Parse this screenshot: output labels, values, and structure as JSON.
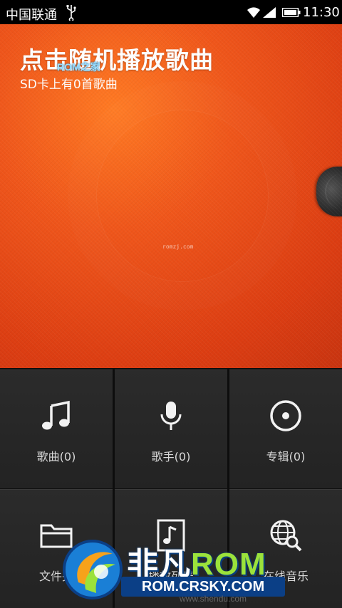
{
  "status_bar": {
    "carrier": "中国联通",
    "time": "11:30",
    "icons": [
      "usb-icon",
      "wifi-icon",
      "signal-icon",
      "battery-icon"
    ]
  },
  "hero": {
    "title": "点击随机播放歌曲",
    "subtitle": "SD卡上有0首歌曲",
    "watermark": "ROM之家",
    "center_text": "romzj.com",
    "colors": {
      "primary": "#ef561b",
      "highlight": "#ff7a23"
    }
  },
  "tiles": [
    {
      "label": "歌曲(0)",
      "icon": "music-note-icon"
    },
    {
      "label": "歌手(0)",
      "icon": "microphone-icon"
    },
    {
      "label": "专辑(0)",
      "icon": "disc-icon"
    },
    {
      "label": "文件夹",
      "icon": "folder-icon"
    },
    {
      "label": "播放列表",
      "icon": "playlist-icon"
    },
    {
      "label": "在线音乐",
      "icon": "globe-search-icon"
    }
  ],
  "brand": {
    "name_cn": "非凡",
    "name_rom": "ROM",
    "url": "ROM.CRSKY.COM",
    "footer_url": "www.shendu.com"
  }
}
